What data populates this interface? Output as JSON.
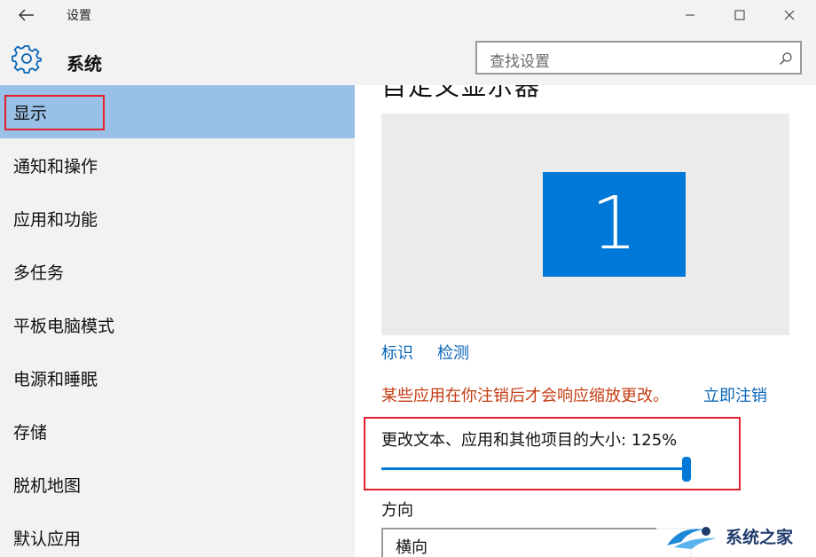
{
  "window": {
    "title": "设置",
    "back_icon": "arrow-left-icon",
    "controls": [
      "minimize-icon",
      "maximize-icon",
      "close-icon"
    ]
  },
  "header": {
    "title": "系统",
    "icon": "gear-icon",
    "search_placeholder": "查找设置",
    "search_icon": "search-icon"
  },
  "sidebar": {
    "items": [
      {
        "label": "显示",
        "selected": true
      },
      {
        "label": "通知和操作"
      },
      {
        "label": "应用和功能"
      },
      {
        "label": "多任务"
      },
      {
        "label": "平板电脑模式"
      },
      {
        "label": "电源和睡眠"
      },
      {
        "label": "存储"
      },
      {
        "label": "脱机地图"
      },
      {
        "label": "默认应用"
      }
    ]
  },
  "main": {
    "heading_partial": "自定义显示器",
    "monitor_number": "1",
    "identify_link": "标识",
    "detect_link": "检测",
    "warning_text": "某些应用在你注销后才会响应缩放更改。",
    "signout_link": "立即注销",
    "scale_label": "更改文本、应用和其他项目的大小: 125%",
    "scale_value_fraction": 1.0,
    "orientation_label": "方向",
    "orientation_value": "横向"
  },
  "watermark": {
    "text": "系统之家"
  },
  "colors": {
    "accent": "#0078d7",
    "selection": "#99c0e6",
    "warning": "#c43c12",
    "link": "#0a66b8",
    "annotation": "#e0202b"
  }
}
